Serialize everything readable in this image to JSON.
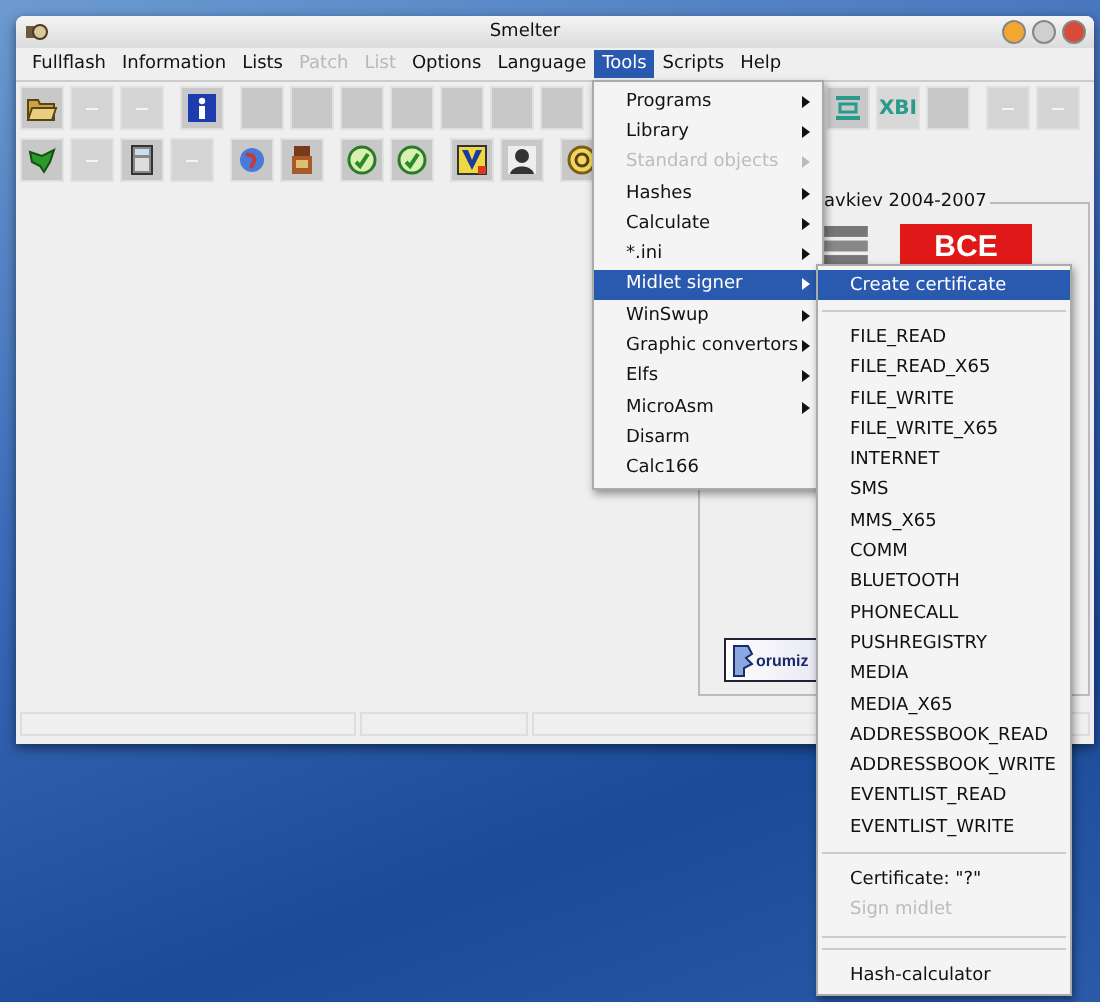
{
  "window": {
    "title": "Smelter"
  },
  "menu": [
    {
      "label": "Fullflash",
      "disabled": false,
      "selected": false
    },
    {
      "label": "Information",
      "disabled": false,
      "selected": false
    },
    {
      "label": "Lists",
      "disabled": false,
      "selected": false
    },
    {
      "label": "Patch",
      "disabled": true,
      "selected": false
    },
    {
      "label": "List",
      "disabled": true,
      "selected": false
    },
    {
      "label": "Options",
      "disabled": false,
      "selected": false
    },
    {
      "label": "Language",
      "disabled": false,
      "selected": false
    },
    {
      "label": "Tools",
      "disabled": false,
      "selected": true
    },
    {
      "label": "Scripts",
      "disabled": false,
      "selected": false
    },
    {
      "label": "Help",
      "disabled": false,
      "selected": false
    }
  ],
  "toolbar_rows": [
    [
      {
        "kind": "open"
      },
      {
        "kind": "blank",
        "disabled": true
      },
      {
        "kind": "blank",
        "disabled": true
      },
      {
        "kind": "separator"
      },
      {
        "kind": "info"
      },
      {
        "kind": "separator"
      },
      {
        "kind": "blank",
        "disabled": false
      },
      {
        "kind": "blank",
        "disabled": false
      },
      {
        "kind": "blank",
        "disabled": false
      },
      {
        "kind": "blank",
        "disabled": false
      },
      {
        "kind": "blank",
        "disabled": false
      },
      {
        "kind": "blank",
        "disabled": false
      },
      {
        "kind": "blank",
        "disabled": false
      },
      {
        "kind": "gap"
      },
      {
        "kind": "list"
      },
      {
        "kind": "text",
        "label": "XBI"
      },
      {
        "kind": "blank",
        "disabled": false
      },
      {
        "kind": "separator"
      },
      {
        "kind": "blank",
        "disabled": true
      },
      {
        "kind": "blank",
        "disabled": true
      }
    ],
    [
      {
        "kind": "bird"
      },
      {
        "kind": "blank",
        "disabled": true
      },
      {
        "kind": "calculator"
      },
      {
        "kind": "blank",
        "disabled": true
      },
      {
        "kind": "separator"
      },
      {
        "kind": "globe"
      },
      {
        "kind": "figure"
      },
      {
        "kind": "separator"
      },
      {
        "kind": "check"
      },
      {
        "kind": "check"
      },
      {
        "kind": "separator"
      },
      {
        "kind": "vlogo"
      },
      {
        "kind": "portrait"
      },
      {
        "kind": "separator"
      },
      {
        "kind": "help"
      }
    ]
  ],
  "about_panel": {
    "caption": "avkiev  2004-2007",
    "badge": "BCE",
    "forum_logo": "orumiz"
  },
  "tools_menu": [
    {
      "label": "Programs",
      "submenu": true,
      "disabled": false,
      "selected": false
    },
    {
      "label": "Library",
      "submenu": true,
      "disabled": false,
      "selected": false
    },
    {
      "label": "Standard objects",
      "submenu": true,
      "disabled": true,
      "selected": false
    },
    {
      "label": "Hashes",
      "submenu": true,
      "disabled": false,
      "selected": false
    },
    {
      "label": "Calculate",
      "submenu": true,
      "disabled": false,
      "selected": false
    },
    {
      "label": "*.ini",
      "submenu": true,
      "disabled": false,
      "selected": false
    },
    {
      "label": "Midlet signer",
      "submenu": true,
      "disabled": false,
      "selected": true
    },
    {
      "label": "WinSwup",
      "submenu": true,
      "disabled": false,
      "selected": false
    },
    {
      "label": "Graphic convertors",
      "submenu": true,
      "disabled": false,
      "selected": false
    },
    {
      "label": "Elfs",
      "submenu": true,
      "disabled": false,
      "selected": false
    },
    {
      "label": "MicroAsm",
      "submenu": true,
      "disabled": false,
      "selected": false
    },
    {
      "label": "Disarm",
      "submenu": false,
      "disabled": false,
      "selected": false
    },
    {
      "label": "Calc166",
      "submenu": false,
      "disabled": false,
      "selected": false
    }
  ],
  "midlet_signer_menu": [
    {
      "kind": "item",
      "label": "Create certificate",
      "disabled": false,
      "selected": true
    },
    {
      "kind": "separator"
    },
    {
      "kind": "item",
      "label": "FILE_READ",
      "disabled": false,
      "selected": false
    },
    {
      "kind": "item",
      "label": "FILE_READ_X65",
      "disabled": false,
      "selected": false
    },
    {
      "kind": "item",
      "label": "FILE_WRITE",
      "disabled": false,
      "selected": false
    },
    {
      "kind": "item",
      "label": "FILE_WRITE_X65",
      "disabled": false,
      "selected": false
    },
    {
      "kind": "item",
      "label": "INTERNET",
      "disabled": false,
      "selected": false
    },
    {
      "kind": "item",
      "label": "SMS",
      "disabled": false,
      "selected": false
    },
    {
      "kind": "item",
      "label": "MMS_X65",
      "disabled": false,
      "selected": false
    },
    {
      "kind": "item",
      "label": "COMM",
      "disabled": false,
      "selected": false
    },
    {
      "kind": "item",
      "label": "BLUETOOTH",
      "disabled": false,
      "selected": false
    },
    {
      "kind": "item",
      "label": "PHONECALL",
      "disabled": false,
      "selected": false
    },
    {
      "kind": "item",
      "label": "PUSHREGISTRY",
      "disabled": false,
      "selected": false
    },
    {
      "kind": "item",
      "label": "MEDIA",
      "disabled": false,
      "selected": false
    },
    {
      "kind": "item",
      "label": "MEDIA_X65",
      "disabled": false,
      "selected": false
    },
    {
      "kind": "item",
      "label": "ADDRESSBOOK_READ",
      "disabled": false,
      "selected": false
    },
    {
      "kind": "item",
      "label": "ADDRESSBOOK_WRITE",
      "disabled": false,
      "selected": false
    },
    {
      "kind": "item",
      "label": "EVENTLIST_READ",
      "disabled": false,
      "selected": false
    },
    {
      "kind": "item",
      "label": "EVENTLIST_WRITE",
      "disabled": false,
      "selected": false
    },
    {
      "kind": "separator"
    },
    {
      "kind": "item",
      "label": "Certificate: \"?\"",
      "disabled": false,
      "selected": false
    },
    {
      "kind": "item",
      "label": "Sign midlet",
      "disabled": true,
      "selected": false
    },
    {
      "kind": "separator"
    },
    {
      "kind": "separator"
    },
    {
      "kind": "item",
      "label": "Hash-calculator",
      "disabled": false,
      "selected": false
    }
  ]
}
